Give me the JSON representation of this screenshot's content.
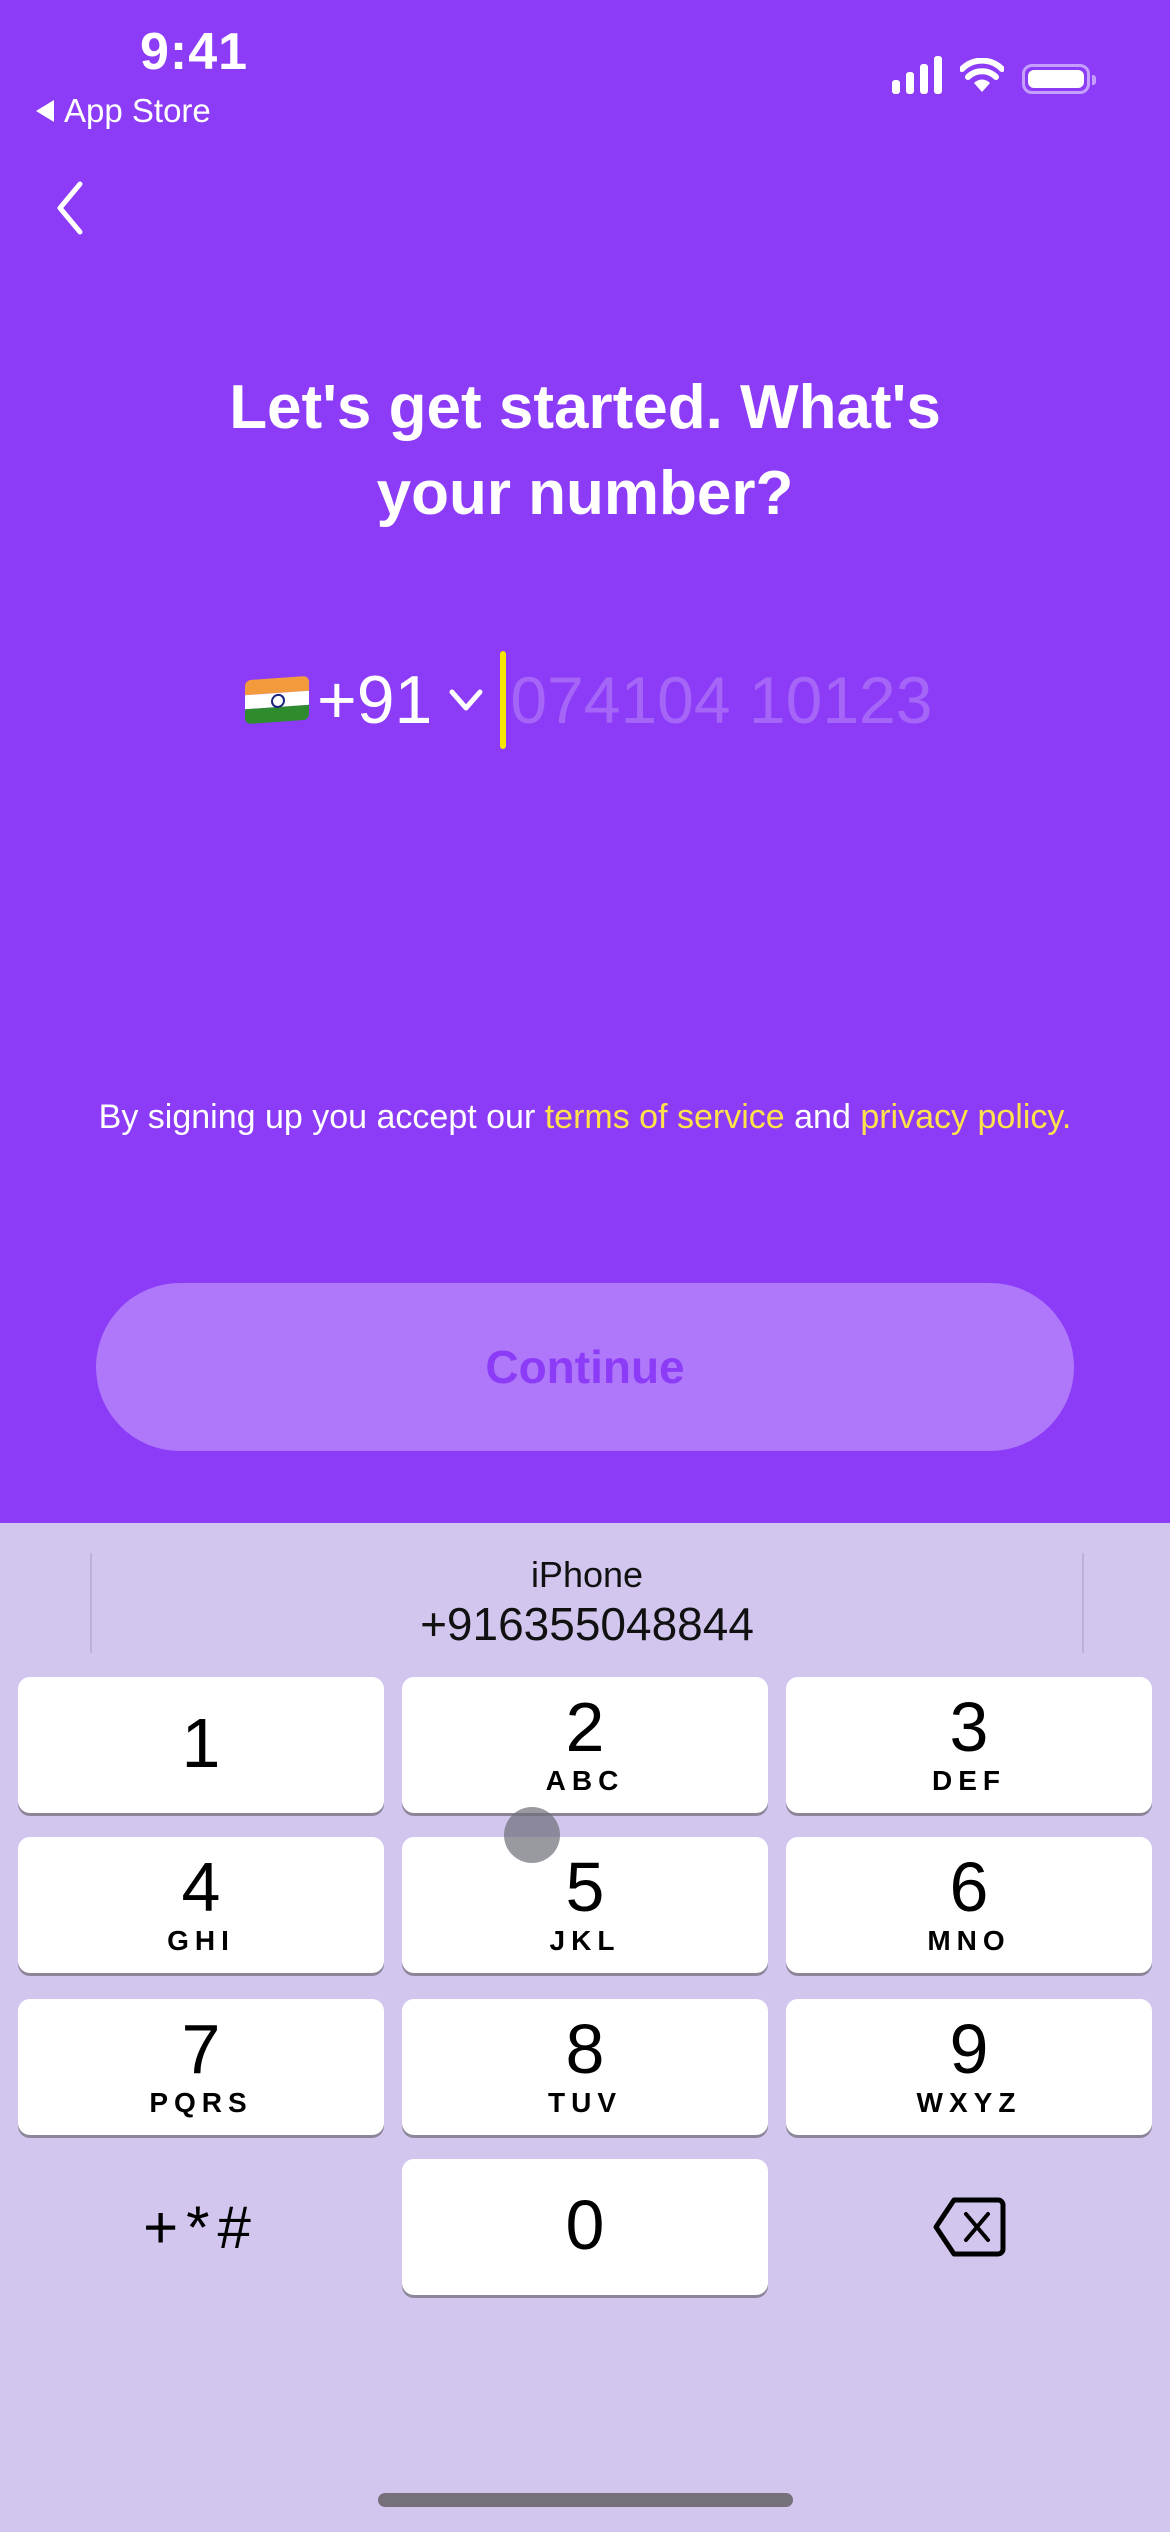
{
  "status_bar": {
    "time": "9:41",
    "back_app": "App Store",
    "icons": [
      "cellular-signal-icon",
      "wifi-icon",
      "battery-icon"
    ]
  },
  "nav": {
    "back_icon": "chevron-left-icon"
  },
  "heading": {
    "line1": "Let's get started. What's",
    "line2": "your number?"
  },
  "phone": {
    "country_flag": "india-flag-icon",
    "country_code": "+91",
    "dropdown_icon": "chevron-down-icon",
    "value": "",
    "placeholder": "074104 10123"
  },
  "terms": {
    "prefix": "By signing up you accept our ",
    "tos_link": "terms of service",
    "middle": " and ",
    "privacy_link": "privacy policy."
  },
  "continue_button": {
    "label": "Continue",
    "enabled": false
  },
  "colors": {
    "primary": "#8c3cf7",
    "accent": "#ffe24a",
    "button_disabled": "#af78fa",
    "keyboard_bg": "#d2c6ee"
  },
  "keyboard": {
    "suggestion": {
      "label": "iPhone",
      "number": "+916355048844"
    },
    "keys": [
      {
        "digit": "1",
        "letters": ""
      },
      {
        "digit": "2",
        "letters": "ABC"
      },
      {
        "digit": "3",
        "letters": "DEF"
      },
      {
        "digit": "4",
        "letters": "GHI"
      },
      {
        "digit": "5",
        "letters": "JKL"
      },
      {
        "digit": "6",
        "letters": "MNO"
      },
      {
        "digit": "7",
        "letters": "PQRS"
      },
      {
        "digit": "8",
        "letters": "TUV"
      },
      {
        "digit": "9",
        "letters": "WXYZ"
      },
      {
        "digit": "0",
        "letters": ""
      }
    ],
    "symbols_label": "+*#",
    "delete_icon": "backspace-icon"
  }
}
